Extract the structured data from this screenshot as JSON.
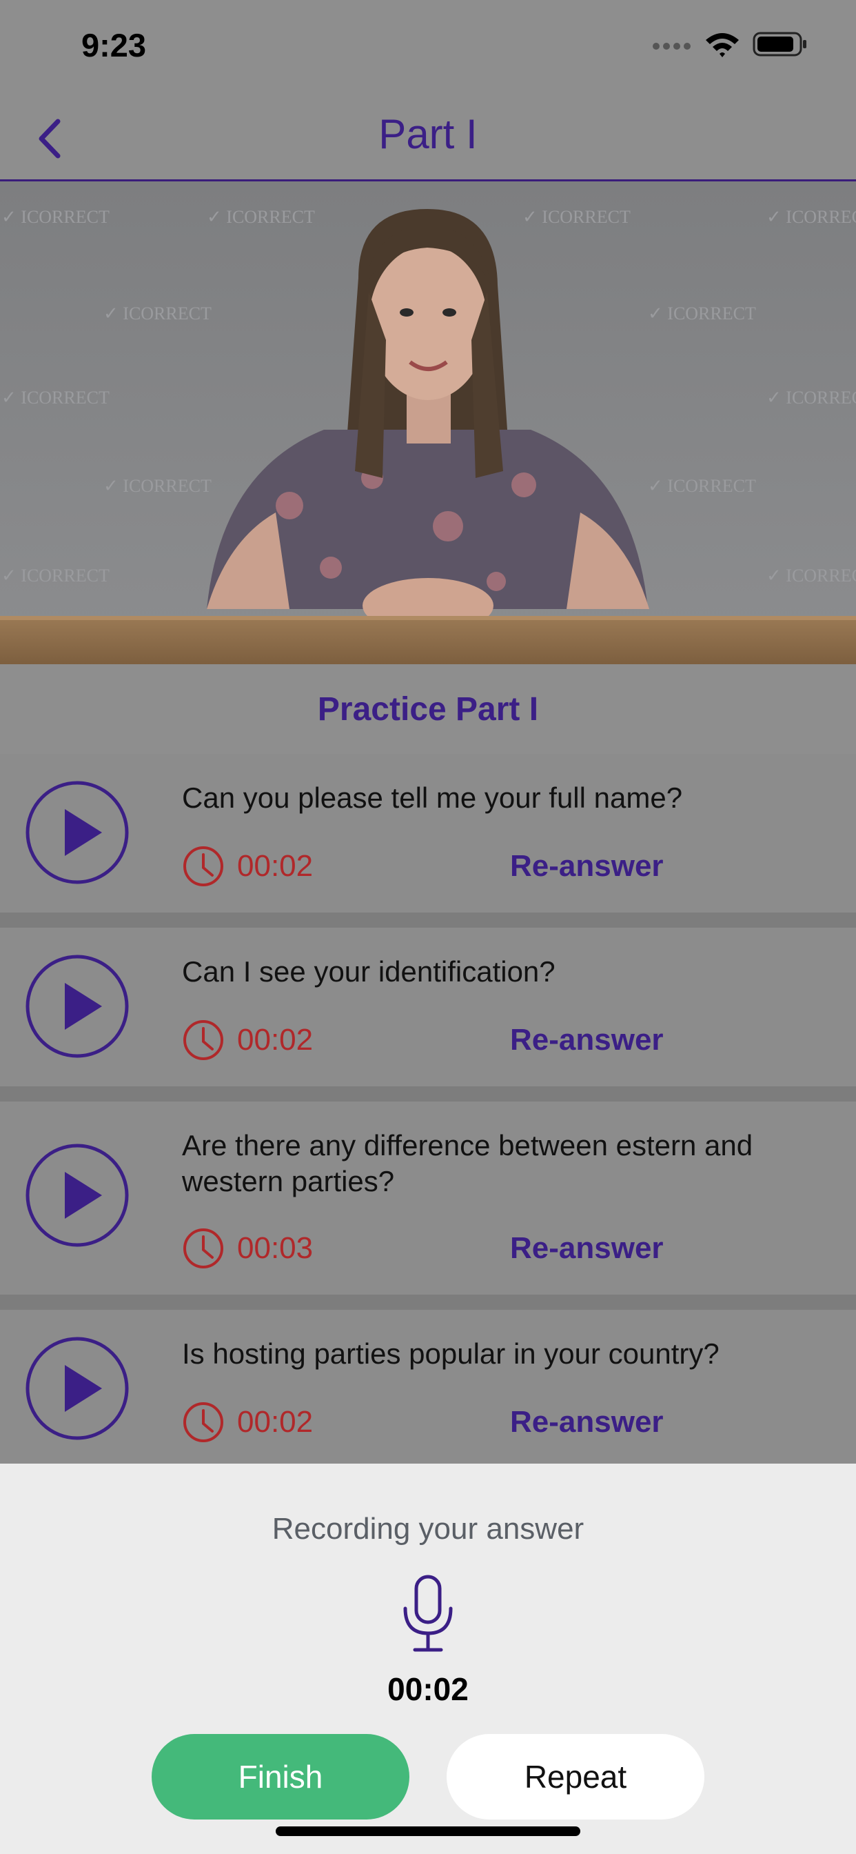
{
  "status_bar": {
    "time": "9:23"
  },
  "nav": {
    "title": "Part I"
  },
  "section": {
    "title": "Practice Part I"
  },
  "questions": [
    {
      "text": "Can you please tell me your full name?",
      "duration": "00:02",
      "action": "Re-answer"
    },
    {
      "text": "Can I see your identification?",
      "duration": "00:02",
      "action": "Re-answer"
    },
    {
      "text": "Are there any difference between estern and western parties?",
      "duration": "00:03",
      "action": "Re-answer"
    },
    {
      "text": "Is hosting parties popular in your country?",
      "duration": "00:02",
      "action": "Re-answer"
    }
  ],
  "recording": {
    "label": "Recording your answer",
    "timer": "00:02",
    "finish_label": "Finish",
    "repeat_label": "Repeat"
  },
  "video": {
    "watermark": "ICORRECT"
  },
  "colors": {
    "accent": "#3b1f86",
    "time_red": "#b0282a",
    "finish_green": "#44b97a"
  }
}
